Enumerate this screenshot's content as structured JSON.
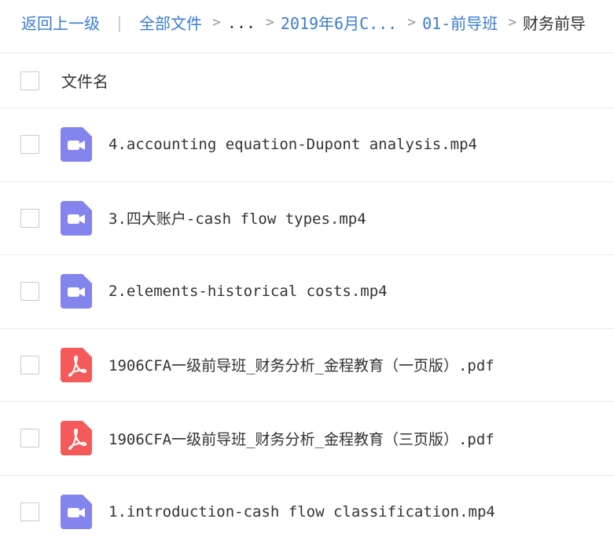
{
  "breadcrumb": {
    "back": "返回上一级",
    "divider": "|",
    "root": "全部文件",
    "separator": ">",
    "ellipsis": "...",
    "folder1": "2019年6月C...",
    "folder2": "01-前导班",
    "current": "财务前导"
  },
  "list_header": {
    "label": "文件名"
  },
  "files": [
    {
      "name": "4.accounting equation-Dupont analysis.mp4",
      "type": "video",
      "icon": "video-file-icon"
    },
    {
      "name": "3.四大账户-cash flow types.mp4",
      "type": "video",
      "icon": "video-file-icon"
    },
    {
      "name": "2.elements-historical costs.mp4",
      "type": "video",
      "icon": "video-file-icon"
    },
    {
      "name": "1906CFA一级前导班_财务分析_金程教育（一页版）.pdf",
      "type": "pdf",
      "icon": "pdf-file-icon"
    },
    {
      "name": "1906CFA一级前导班_财务分析_金程教育（三页版）.pdf",
      "type": "pdf",
      "icon": "pdf-file-icon"
    },
    {
      "name": "1.introduction-cash flow classification.mp4",
      "type": "video",
      "icon": "video-file-icon"
    }
  ],
  "colors": {
    "link": "#3a7bd5",
    "video_icon": "#8484ee",
    "pdf_icon": "#f45a5a",
    "row_border": "#ececec"
  }
}
